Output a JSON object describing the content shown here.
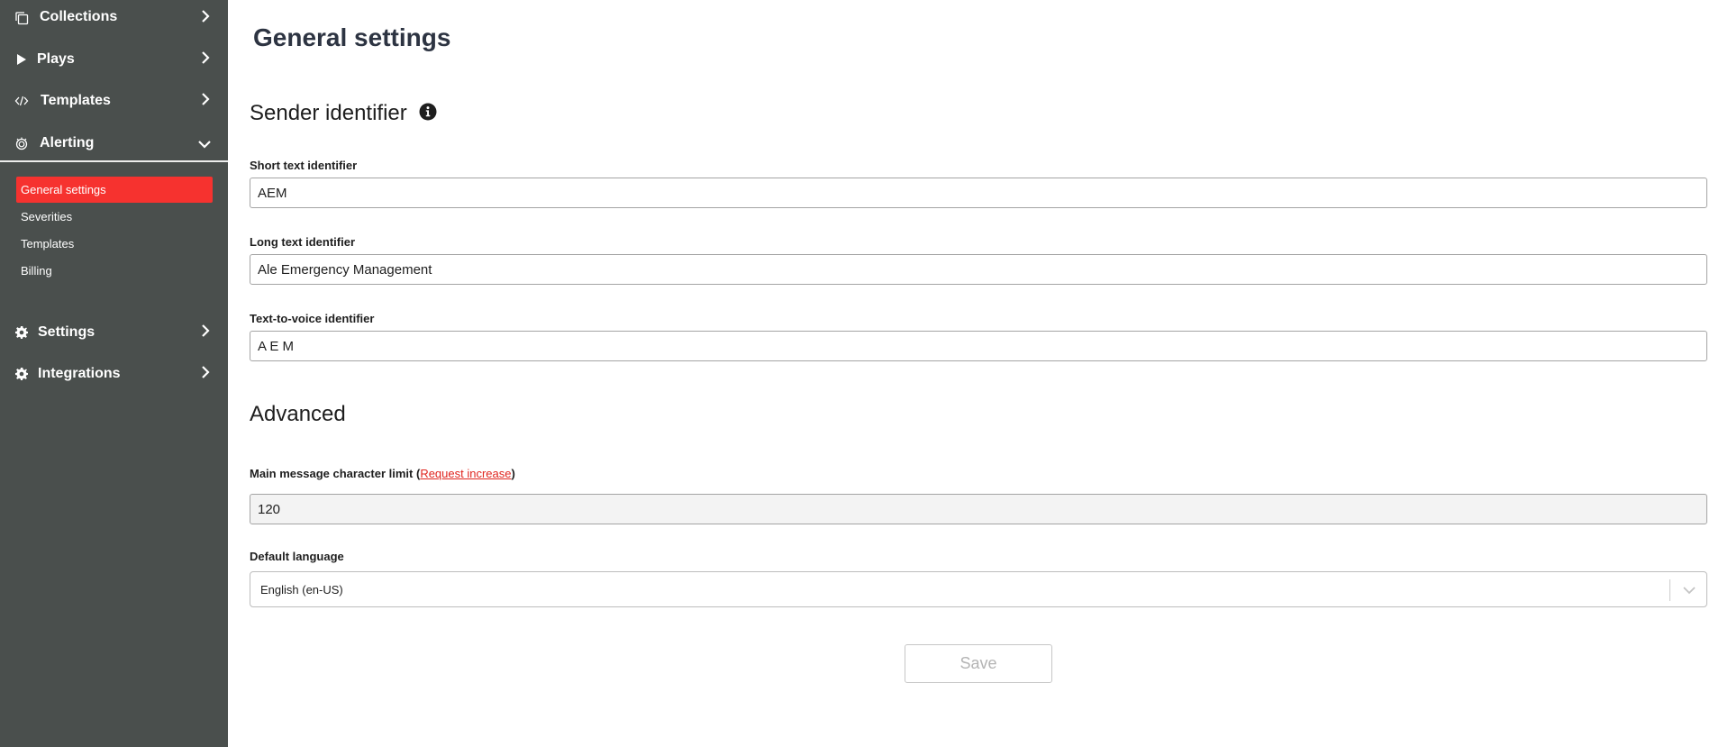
{
  "sidebar": {
    "items": [
      {
        "label": "Collections",
        "icon": "copy-icon"
      },
      {
        "label": "Plays",
        "icon": "play-icon"
      },
      {
        "label": "Templates",
        "icon": "code-icon"
      },
      {
        "label": "Alerting",
        "icon": "alert-icon"
      },
      {
        "label": "Settings",
        "icon": "gear-icon"
      },
      {
        "label": "Integrations",
        "icon": "gear-icon"
      }
    ],
    "alerting_sub": [
      {
        "label": "General settings",
        "active": true
      },
      {
        "label": "Severities"
      },
      {
        "label": "Templates"
      },
      {
        "label": "Billing"
      }
    ]
  },
  "main": {
    "title": "General settings",
    "sender": {
      "title": "Sender identifier",
      "short_label": "Short text identifier",
      "short_value": "AEM",
      "long_label": "Long text identifier",
      "long_value": "Ale Emergency Management",
      "tts_label": "Text-to-voice identifier",
      "tts_value": "A E M"
    },
    "advanced": {
      "title": "Advanced",
      "limit_label": "Main message character limit (",
      "limit_link": "Request increase",
      "limit_suffix": ")",
      "limit_value": "120",
      "language_label": "Default language",
      "language_value": "English (en-US)"
    },
    "save_label": "Save"
  },
  "colors": {
    "sidebar_bg": "#4a4f4d",
    "active_item": "#f6322f",
    "link": "#e0261f"
  }
}
